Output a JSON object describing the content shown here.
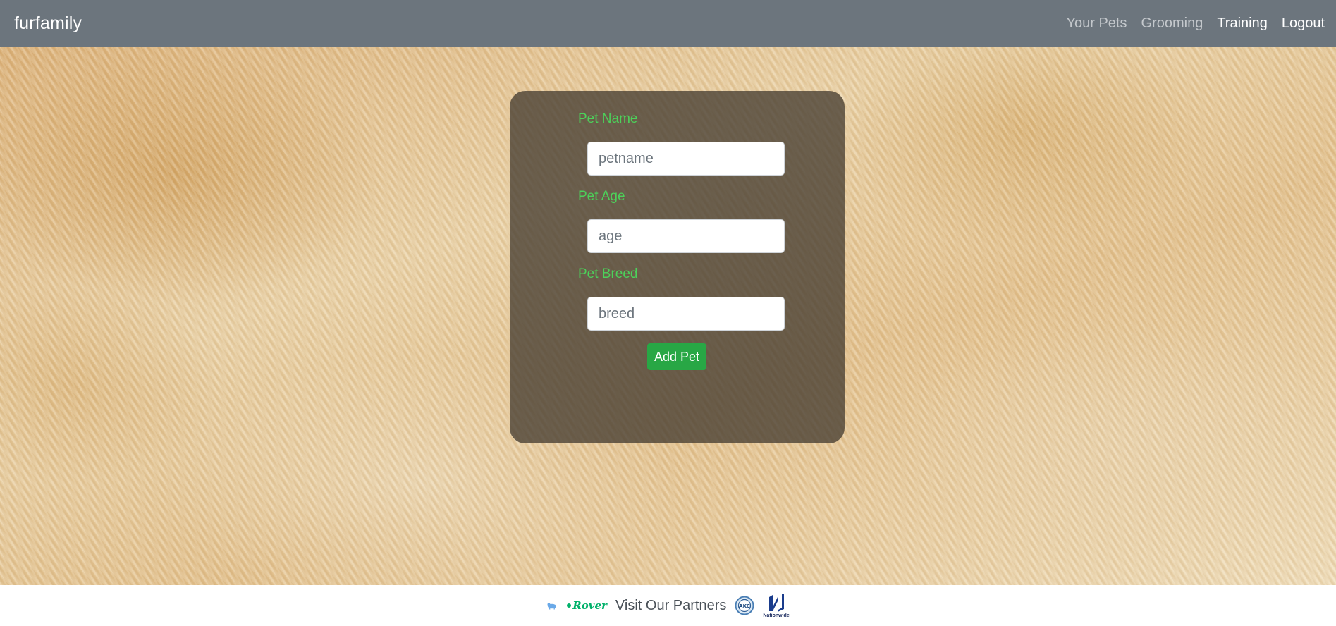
{
  "navbar": {
    "brand": "furfamily",
    "links": [
      {
        "label": "Your Pets",
        "state": "muted"
      },
      {
        "label": "Grooming",
        "state": "muted"
      },
      {
        "label": "Training",
        "state": "active"
      },
      {
        "label": "Logout",
        "state": "active"
      }
    ],
    "background_color": "#6c757d"
  },
  "form": {
    "fields": [
      {
        "label": "Pet Name",
        "placeholder": "petname",
        "value": ""
      },
      {
        "label": "Pet Age",
        "placeholder": "age",
        "value": ""
      },
      {
        "label": "Pet Breed",
        "placeholder": "breed",
        "value": ""
      }
    ],
    "submit_label": "Add Pet",
    "label_color": "#4cd15a",
    "button_color": "#28a745"
  },
  "footer": {
    "text": "Visit Our Partners",
    "partners": [
      {
        "icon": "small-dog-logo-icon"
      },
      {
        "icon": "rover-logo-icon",
        "wordmark": "Rover"
      },
      {
        "icon": "akc-logo-icon",
        "wordmark": "AKC"
      },
      {
        "icon": "nationwide-logo-icon",
        "wordmark": "Nationwide"
      }
    ]
  }
}
